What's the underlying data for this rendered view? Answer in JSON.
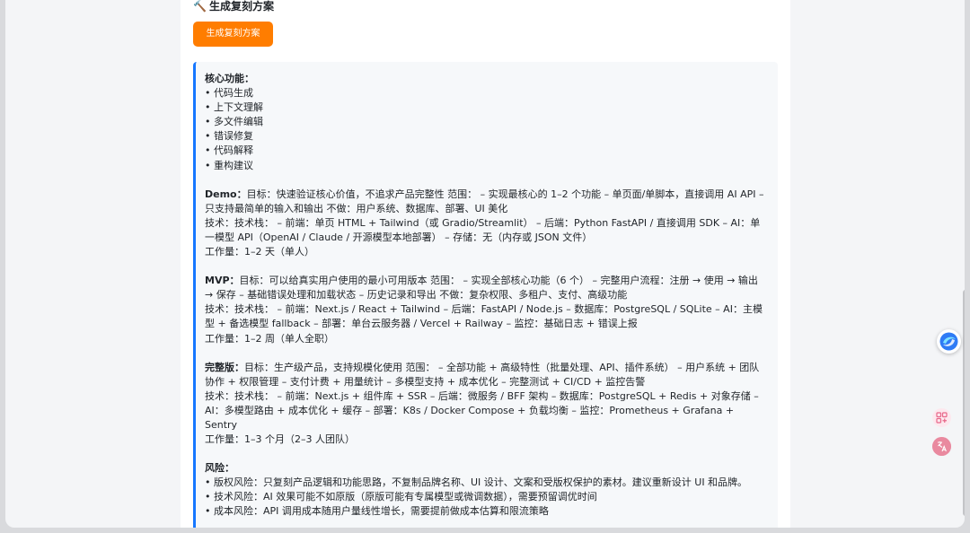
{
  "section": {
    "title": "生成复刻方案",
    "icon": "hammer-icon",
    "button_label": "生成复刻方案",
    "button_color": "#ff7d00"
  },
  "result": {
    "accent_color": "#1677ff",
    "core": {
      "heading": "核心功能：",
      "items": [
        "• 代码生成",
        "• 上下文理解",
        "• 多文件编辑",
        "• 错误修复",
        "• 代码解释",
        "• 重构建议"
      ]
    },
    "demo": {
      "label": "Demo：",
      "goal": "目标：快速验证核心价值，不追求产品完整性 范围： – 实现最核心的 1–2 个功能 – 单页面/单脚本，直接调用 AI API – 只支持最简单的输入和输出 不做：用户系统、数据库、部署、UI 美化",
      "tech": "技术：技术栈： – 前端：单页 HTML + Tailwind（或 Gradio/Streamlit） – 后端：Python FastAPI / 直接调用 SDK – AI：单一模型 API（OpenAI / Claude / 开源模型本地部署） – 存储：无（内存或 JSON 文件）",
      "effort": "工作量：1–2 天（单人）"
    },
    "mvp": {
      "label": "MVP：",
      "goal": "目标：可以给真实用户使用的最小可用版本 范围： – 实现全部核心功能（6 个） – 完整用户流程：注册 → 使用 → 输出 → 保存 – 基础错误处理和加载状态 – 历史记录和导出 不做：复杂权限、多租户、支付、高级功能",
      "tech": "技术：技术栈： – 前端：Next.js / React + Tailwind – 后端：FastAPI / Node.js – 数据库：PostgreSQL / SQLite – AI：主模型 + 备选模型 fallback – 部署：单台云服务器 / Vercel + Railway – 监控：基础日志 + 错误上报",
      "effort": "工作量：1–2 周（单人全职）"
    },
    "full": {
      "label": "完整版：",
      "goal": "目标：生产级产品，支持规模化使用 范围： – 全部功能 + 高级特性（批量处理、API、插件系统） – 用户系统 + 团队协作 + 权限管理 – 支付计费 + 用量统计 – 多模型支持 + 成本优化 – 完整测试 + CI/CD + 监控告警",
      "tech": "技术：技术栈： – 前端：Next.js + 组件库 + SSR – 后端：微服务 / BFF 架构 – 数据库：PostgreSQL + Redis + 对象存储 – AI：多模型路由 + 成本优化 + 缓存 – 部署：K8s / Docker Compose + 负载均衡 – 监控：Prometheus + Grafana + Sentry",
      "effort": "工作量：1–3 个月（2–3 人团队）"
    },
    "risk": {
      "heading": "风险：",
      "items": [
        "• 版权风险：只复刻产品逻辑和功能思路，不复制品牌名称、UI 设计、文案和受版权保护的素材。建议重新设计 UI 和品牌。",
        "• 技术风险：AI 效果可能不如原版（原版可能有专属模型或微调数据），需要预留调优时间",
        "• 成本风险：API 调用成本随用户量线性增长，需要提前做成本估算和限流策略"
      ]
    }
  },
  "floating": {
    "assistant_icon": "ai-assistant-icon",
    "side_icon_1": "apps-grid-icon",
    "side_icon_2": "translate-icon"
  }
}
